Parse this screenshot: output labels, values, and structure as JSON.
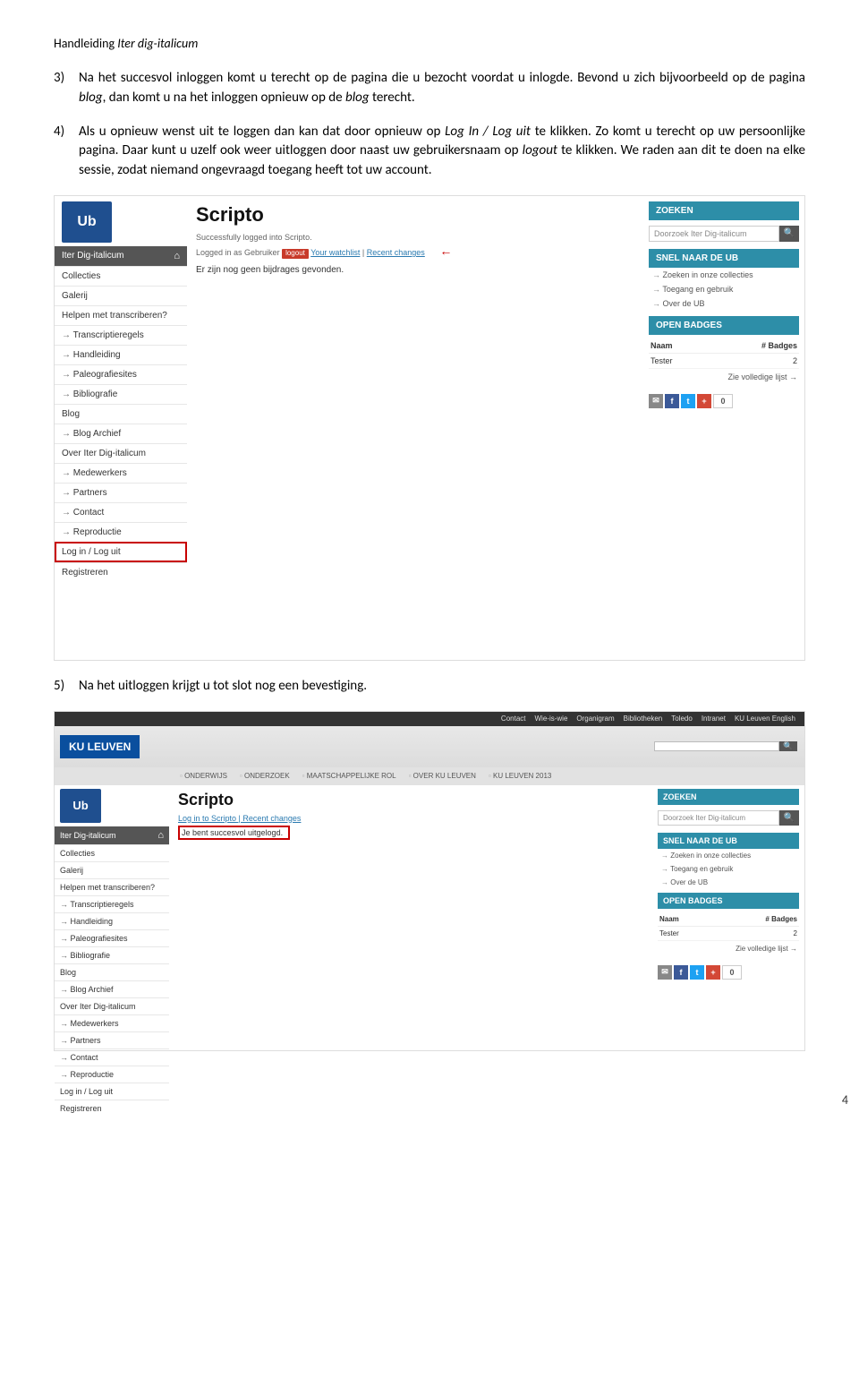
{
  "header": {
    "prefix": "Handleiding ",
    "italic": "Iter dig-italicum"
  },
  "items": [
    {
      "num": "3)",
      "segments": [
        {
          "t": "Na het succesvol inloggen komt u terecht op de pagina die u bezocht voordat u inlogde. Bevond u zich bijvoorbeeld op de pagina "
        },
        {
          "t": "blog",
          "i": true
        },
        {
          "t": ", dan komt u na het inloggen opnieuw op de "
        },
        {
          "t": "blog",
          "i": true
        },
        {
          "t": " terecht."
        }
      ]
    },
    {
      "num": "4)",
      "segments": [
        {
          "t": "Als u opnieuw wenst uit te loggen dan kan dat door opnieuw op "
        },
        {
          "t": "Log In / Log uit",
          "i": true
        },
        {
          "t": " te klikken. Zo komt u terecht op uw persoonlijke pagina. Daar kunt u uzelf ook weer uitloggen door naast uw gebruikersnaam op "
        },
        {
          "t": "logout",
          "i": true
        },
        {
          "t": " te klikken. We raden aan dit te doen na elke sessie, zodat niemand ongevraagd toegang heeft tot uw account."
        }
      ]
    },
    {
      "num": "5)",
      "segments": [
        {
          "t": "Na het uitloggen krijgt u tot slot nog een bevestiging."
        }
      ]
    }
  ],
  "shot1": {
    "logo": "Ub",
    "sideHead": "Iter Dig-italicum",
    "sidebar": [
      "Collecties",
      "Galerij",
      "Helpen met transcriberen?"
    ],
    "sidebarArrow": [
      "Transcriptieregels",
      "Handleiding",
      "Paleografiesites",
      "Bibliografie"
    ],
    "sidebar2": [
      "Blog"
    ],
    "sidebarArrow2": [
      "Blog Archief"
    ],
    "sidebar3": [
      "Over Iter Dig-italicum"
    ],
    "sidebarArrow3": [
      "Medewerkers",
      "Partners",
      "Contact",
      "Reproductie"
    ],
    "hl": "Log in / Log uit",
    "sidebar4": [
      "Registreren"
    ],
    "title": "Scripto",
    "line1": "Successfully logged into Scripto.",
    "line2a": "Logged in as Gebruiker ",
    "chip": "logout",
    "line2b": "Your watchlist",
    "line2c": "Recent changes",
    "arrow": "←",
    "msg": "Er zijn nog geen bijdrages gevonden.",
    "zoeken": "ZOEKEN",
    "searchPH": "Doorzoek Iter Dig-italicum",
    "snel": "SNEL NAAR DE UB",
    "snelLinks": [
      "Zoeken in onze collecties",
      "Toegang en gebruik",
      "Over de UB"
    ],
    "open": "OPEN BADGES",
    "bHdrL": "Naam",
    "bHdrR": "# Badges",
    "bRowL": "Tester",
    "bRowR": "2",
    "full": "Zie volledige lijst",
    "count": "0"
  },
  "shot2": {
    "topnav": [
      "Contact",
      "Wie-is-wie",
      "Organigram",
      "Bibliotheken",
      "Toledo",
      "Intranet",
      "KU Leuven English"
    ],
    "kul": "KU LEUVEN",
    "menu": [
      "ONDERWIJS",
      "ONDERZOEK",
      "MAATSCHAPPELIJKE ROL",
      "OVER KU LEUVEN",
      "KU LEUVEN 2013"
    ],
    "logo": "Ub",
    "sideHead": "Iter Dig-italicum",
    "sidebar": [
      "Collecties",
      "Galerij",
      "Helpen met transcriberen?"
    ],
    "sidebarArrow": [
      "Transcriptieregels",
      "Handleiding",
      "Paleografiesites",
      "Bibliografie"
    ],
    "sidebar2": [
      "Blog"
    ],
    "sidebarArrow2": [
      "Blog Archief"
    ],
    "sidebar3": [
      "Over Iter Dig-italicum"
    ],
    "sidebarArrow3": [
      "Medewerkers",
      "Partners",
      "Contact",
      "Reproductie"
    ],
    "sidebar4": [
      "Log in / Log uit",
      "Registreren"
    ],
    "title": "Scripto",
    "links": "Log in to Scripto | Recent changes",
    "redmsg": "Je bent succesvol uitgelogd.",
    "zoeken": "ZOEKEN",
    "searchPH": "Doorzoek Iter Dig-italicum",
    "snel": "SNEL NAAR DE UB",
    "snelLinks": [
      "Zoeken in onze collecties",
      "Toegang en gebruik",
      "Over de UB"
    ],
    "open": "OPEN BADGES",
    "bHdrL": "Naam",
    "bHdrR": "# Badges",
    "bRowL": "Tester",
    "bRowR": "2",
    "full": "Zie volledige lijst",
    "count": "0"
  },
  "pageNum": "4"
}
